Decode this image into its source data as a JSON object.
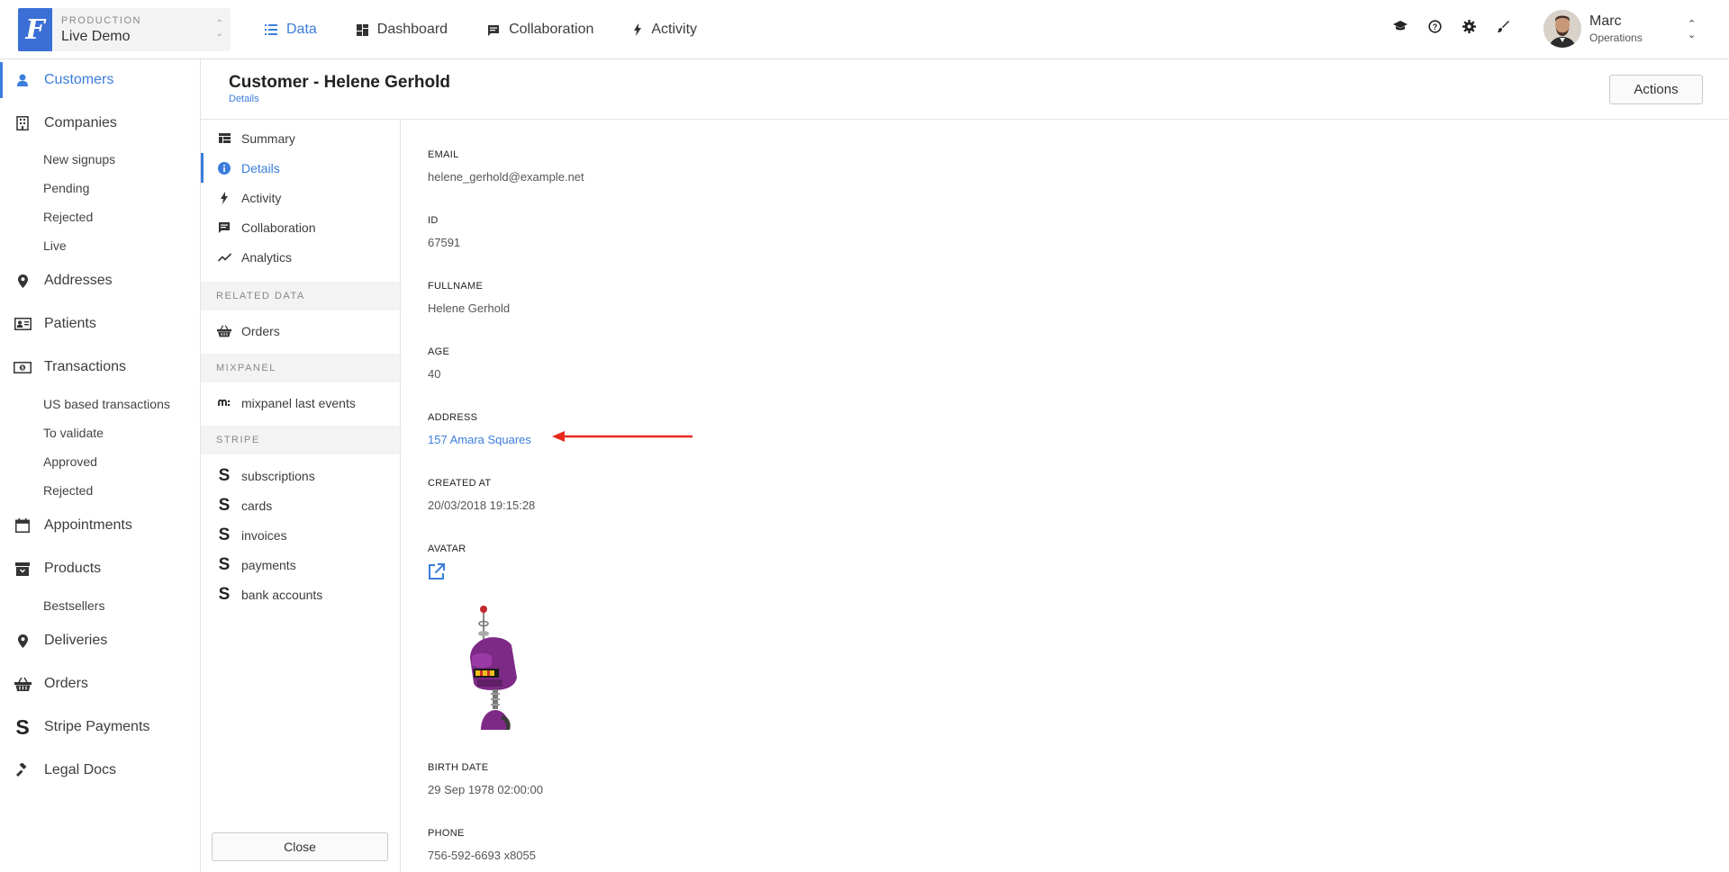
{
  "project": {
    "environment": "PRODUCTION",
    "name": "Live Demo",
    "logo_letter": "F"
  },
  "main_nav": [
    {
      "label": "Data",
      "icon": "list-icon",
      "active": true
    },
    {
      "label": "Dashboard",
      "icon": "dashboard-icon",
      "active": false
    },
    {
      "label": "Collaboration",
      "icon": "chat-icon",
      "active": false
    },
    {
      "label": "Activity",
      "icon": "bolt-icon",
      "active": false
    }
  ],
  "top_icons": [
    "graduation-cap-icon",
    "help-icon",
    "gear-icon",
    "brush-icon"
  ],
  "user": {
    "name": "Marc",
    "role": "Operations"
  },
  "sidebar": {
    "items": [
      {
        "label": "Customers",
        "icon": "person-icon",
        "active": true
      },
      {
        "label": "Companies",
        "icon": "building-icon"
      },
      {
        "label": "Addresses",
        "icon": "map-pin-icon"
      },
      {
        "label": "Patients",
        "icon": "id-card-icon"
      },
      {
        "label": "Transactions",
        "icon": "money-icon"
      },
      {
        "label": "Appointments",
        "icon": "calendar-icon"
      },
      {
        "label": "Products",
        "icon": "archive-icon"
      },
      {
        "label": "Deliveries",
        "icon": "map-pin-icon"
      },
      {
        "label": "Orders",
        "icon": "basket-icon"
      },
      {
        "label": "Stripe Payments",
        "icon": "stripe-icon"
      },
      {
        "label": "Legal Docs",
        "icon": "gavel-icon"
      }
    ],
    "companies_sub": [
      "New signups",
      "Pending",
      "Rejected",
      "Live"
    ],
    "transactions_sub": [
      "US based transactions",
      "To validate",
      "Approved",
      "Rejected"
    ],
    "products_sub": [
      "Bestsellers"
    ]
  },
  "header": {
    "title": "Customer - Helene Gerhold",
    "subtitle": "Details",
    "actions_label": "Actions"
  },
  "subnav": {
    "items": [
      {
        "label": "Summary",
        "icon": "summary-icon"
      },
      {
        "label": "Details",
        "icon": "info-icon",
        "active": true
      },
      {
        "label": "Activity",
        "icon": "bolt-icon"
      },
      {
        "label": "Collaboration",
        "icon": "chat-icon"
      },
      {
        "label": "Analytics",
        "icon": "trend-icon"
      }
    ],
    "related_title": "RELATED DATA",
    "related": [
      {
        "label": "Orders",
        "icon": "basket-icon"
      }
    ],
    "mixpanel_title": "MIXPANEL",
    "mixpanel": [
      {
        "label": "mixpanel last events",
        "icon": "mixpanel-icon"
      }
    ],
    "stripe_title": "STRIPE",
    "stripe": [
      {
        "label": "subscriptions",
        "icon": "stripe-icon"
      },
      {
        "label": "cards",
        "icon": "stripe-icon"
      },
      {
        "label": "invoices",
        "icon": "stripe-icon"
      },
      {
        "label": "payments",
        "icon": "stripe-icon"
      },
      {
        "label": "bank accounts",
        "icon": "stripe-icon"
      }
    ],
    "close_label": "Close"
  },
  "fields": {
    "email": {
      "label": "EMAIL",
      "value": "helene_gerhold@example.net"
    },
    "id": {
      "label": "ID",
      "value": "67591"
    },
    "fullname": {
      "label": "FULLNAME",
      "value": "Helene Gerhold"
    },
    "age": {
      "label": "AGE",
      "value": "40"
    },
    "address": {
      "label": "ADDRESS",
      "value": "157 Amara Squares"
    },
    "created_at": {
      "label": "CREATED AT",
      "value": "20/03/2018 19:15:28"
    },
    "avatar": {
      "label": "AVATAR"
    },
    "birth_date": {
      "label": "BIRTH DATE",
      "value": "29 Sep 1978 02:00:00"
    },
    "phone": {
      "label": "PHONE",
      "value": "756-592-6693 x8055"
    }
  },
  "colors": {
    "accent": "#3b7ddd",
    "annotation": "#e8281e",
    "robot_body": "#7d2a86"
  }
}
